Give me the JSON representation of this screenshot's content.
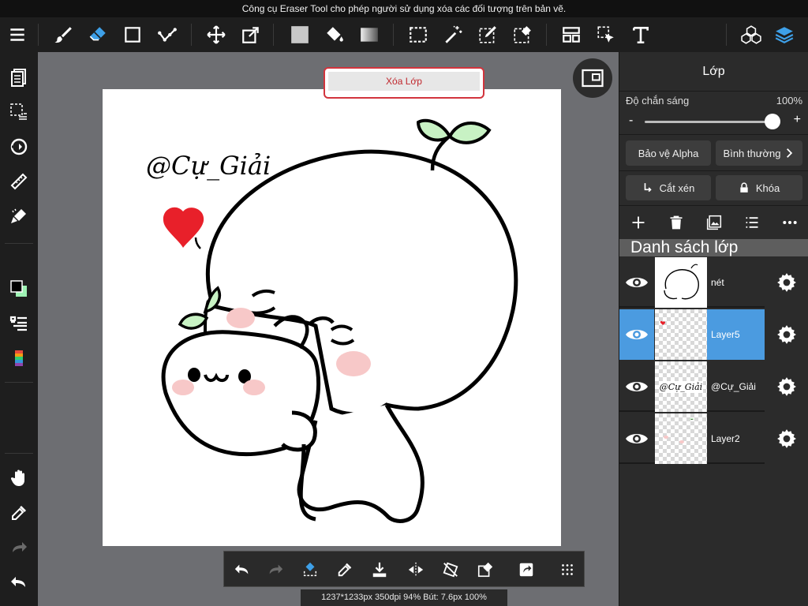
{
  "hint": "Công cụ Eraser Tool cho phép người sử dụng xóa các đối tượng trên bản vẽ.",
  "toolbar": {
    "tools": [
      "menu-icon",
      "brush-icon",
      "eraser-icon",
      "shape-icon",
      "correction-icon",
      "move-icon",
      "transform-icon",
      "fill-rect-icon",
      "bucket-icon",
      "gradient-icon",
      "select-rect-icon",
      "magic-wand-icon",
      "select-pen-icon",
      "select-eraser-icon",
      "layout-icon",
      "select-cursor-icon",
      "text-icon",
      "materials-icon",
      "layers-icon"
    ],
    "active_tool": "eraser-icon"
  },
  "toast": {
    "label": "Xóa Lớp"
  },
  "canvas": {
    "watermark": "@Cự_Giải"
  },
  "bottom": {
    "tools": [
      "undo-icon",
      "redo-icon",
      "eraser-transform-icon",
      "eyedropper-icon",
      "import-icon",
      "flip-icon",
      "rotate-reset-icon",
      "clear-icon",
      "share-icon",
      "grid-dots-icon"
    ]
  },
  "status": "1237*1233px 350dpi 94% Bút: 7.6px 100%",
  "panel": {
    "title": "Lớp",
    "opacity_label": "Độ chắn sáng",
    "opacity_value": "100%",
    "opacity_fraction": 1.0,
    "minus": "-",
    "plus": "+",
    "protect_alpha": "Bảo vệ Alpha",
    "blend_mode": "Bình thường",
    "clip_label": "Cắt xén",
    "lock_label": "Khóa",
    "list_header": "Danh sách lớp",
    "layers": [
      {
        "name": "nét",
        "selected": false
      },
      {
        "name": "Layer5",
        "selected": true
      },
      {
        "name": "@Cự_Giải",
        "selected": false
      },
      {
        "name": "Layer2",
        "selected": false
      }
    ]
  },
  "colors": {
    "selected": "#4b9be0",
    "primary": "#000000",
    "secondary": "#9ef2b4",
    "alert": "#d2343d"
  }
}
